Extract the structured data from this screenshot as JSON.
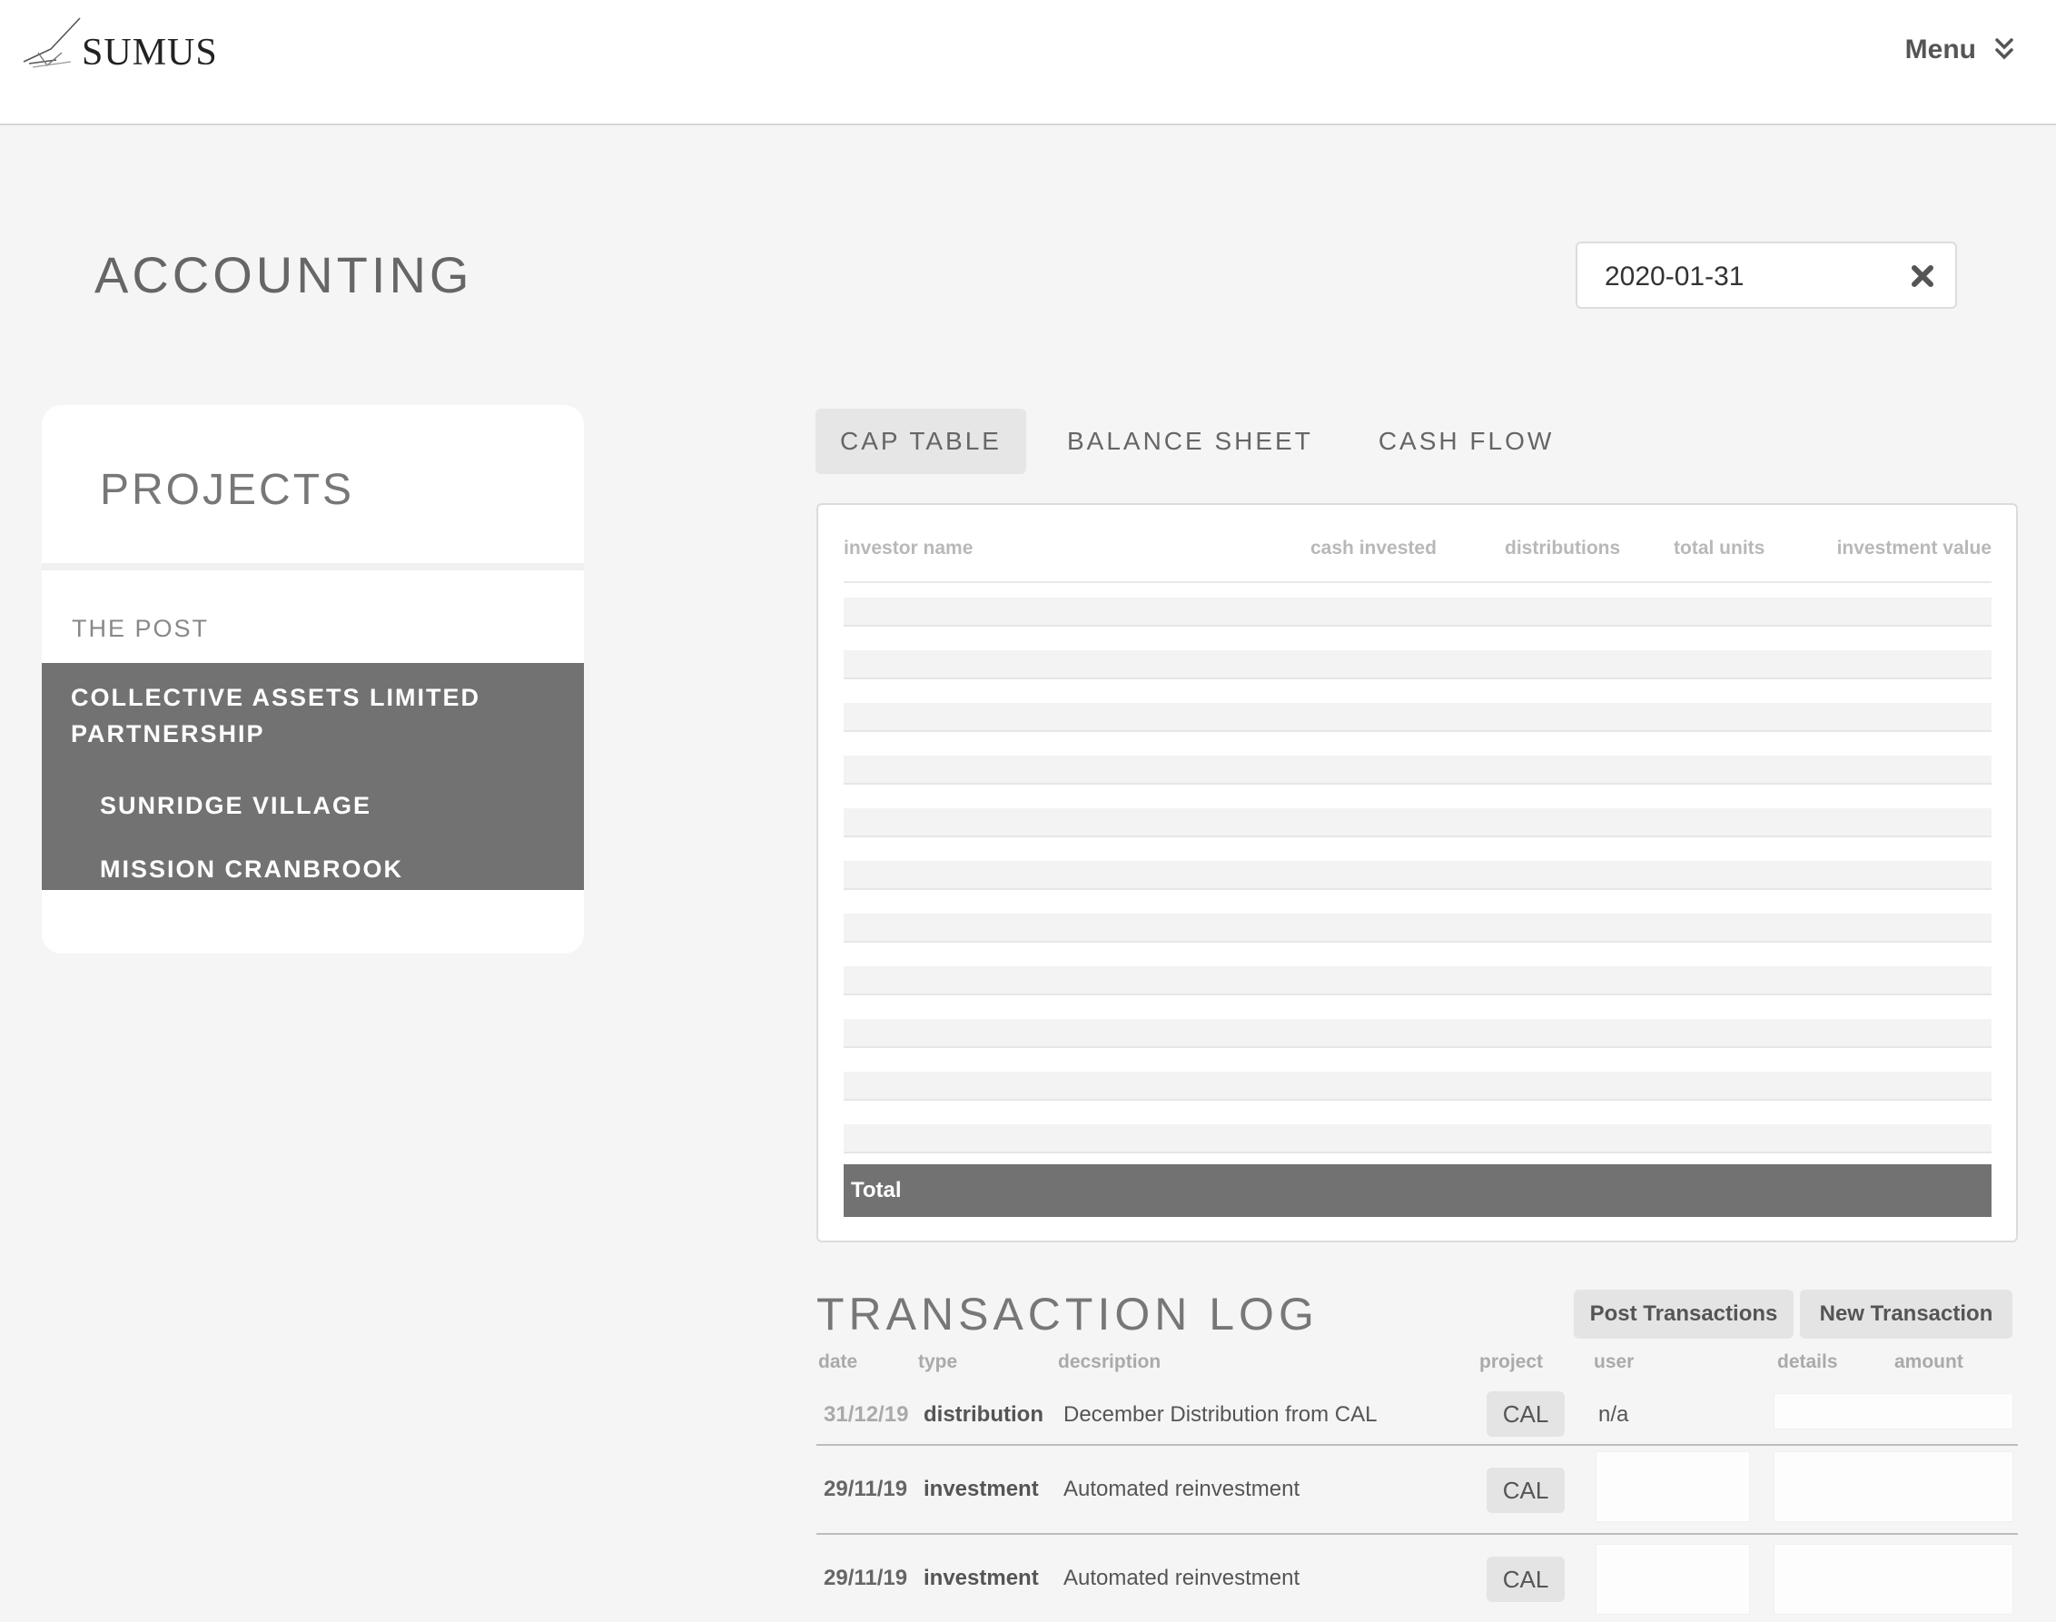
{
  "brand": {
    "name": "SUMUS"
  },
  "nav": {
    "menu_label": "Menu"
  },
  "page": {
    "title": "ACCOUNTING"
  },
  "date_filter": {
    "value": "2020-01-31"
  },
  "projects": {
    "title": "PROJECTS",
    "items": [
      {
        "label": "THE POST"
      },
      {
        "label": "COLLECTIVE ASSETS LIMITED PARTNERSHIP"
      },
      {
        "label": "SUNRIDGE VILLAGE"
      },
      {
        "label": "MISSION CRANBROOK"
      }
    ]
  },
  "tabs": [
    {
      "label": "CAP TABLE",
      "active": true
    },
    {
      "label": "BALANCE SHEET",
      "active": false
    },
    {
      "label": "CASH FLOW",
      "active": false
    }
  ],
  "cap_table": {
    "columns": [
      "investor name",
      "cash invested",
      "distributions",
      "total units",
      "investment value"
    ],
    "total_label": "Total"
  },
  "transaction_log": {
    "title": "TRANSACTION LOG",
    "post_button": "Post Transactions",
    "new_button": "New Transaction",
    "columns": [
      "date",
      "type",
      "decsription",
      "project",
      "user",
      "details",
      "amount"
    ],
    "rows": [
      {
        "date": "31/12/19",
        "type": "distribution",
        "description": "December Distribution from CAL",
        "project": "CAL",
        "user": "n/a"
      },
      {
        "date": "29/11/19",
        "type": "investment",
        "description": "Automated reinvestment",
        "project": "CAL",
        "user": ""
      },
      {
        "date": "29/11/19",
        "type": "investment",
        "description": "Automated reinvestment",
        "project": "CAL",
        "user": ""
      }
    ]
  }
}
